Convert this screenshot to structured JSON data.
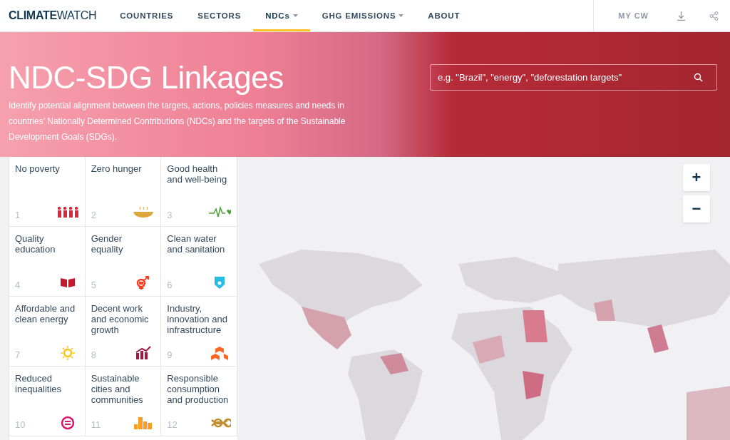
{
  "header": {
    "logo_bold": "CLIMATE",
    "logo_light": "WATCH",
    "nav": [
      {
        "label": "COUNTRIES",
        "selected": false,
        "has_menu": false
      },
      {
        "label": "SECTORS",
        "selected": false,
        "has_menu": false
      },
      {
        "label": "NDCs",
        "selected": true,
        "has_menu": true
      },
      {
        "label": "GHG EMISSIONS",
        "selected": false,
        "has_menu": true
      },
      {
        "label": "ABOUT",
        "selected": false,
        "has_menu": false
      }
    ],
    "my_cw": "MY CW"
  },
  "hero": {
    "title": "NDC-SDG Linkages",
    "description": "Identify potential alignment between the targets, actions, policies measures and needs in countries’ Nationally Determined Contributions (NDCs) and the targets of the Sustainable Development Goals (SDGs).",
    "search": {
      "placeholder": "e.g. \"Brazil\", \"energy\", \"deforestation targets\""
    }
  },
  "goals": [
    {
      "number": "1",
      "title": "No poverty",
      "color": "#e5243b"
    },
    {
      "number": "2",
      "title": "Zero hunger",
      "color": "#dda63a"
    },
    {
      "number": "3",
      "title": "Good health and well-being",
      "color": "#4c9f38"
    },
    {
      "number": "4",
      "title": "Quality education",
      "color": "#c5192d"
    },
    {
      "number": "5",
      "title": "Gender equality",
      "color": "#ff3a21"
    },
    {
      "number": "6",
      "title": "Clean water and sanitation",
      "color": "#26bde2"
    },
    {
      "number": "7",
      "title": "Affordable and clean energy",
      "color": "#fcc30b"
    },
    {
      "number": "8",
      "title": "Decent work and economic growth",
      "color": "#a21942"
    },
    {
      "number": "9",
      "title": "Industry, innovation and infrastructure",
      "color": "#fd6925"
    },
    {
      "number": "10",
      "title": "Reduced inequalities",
      "color": "#dd1367"
    },
    {
      "number": "11",
      "title": "Sustainable cities and communities",
      "color": "#fd9d24"
    },
    {
      "number": "12",
      "title": "Responsible consumption and production",
      "color": "#bf8b2e"
    }
  ],
  "map": {
    "zoom_in": "+",
    "zoom_out": "−"
  }
}
